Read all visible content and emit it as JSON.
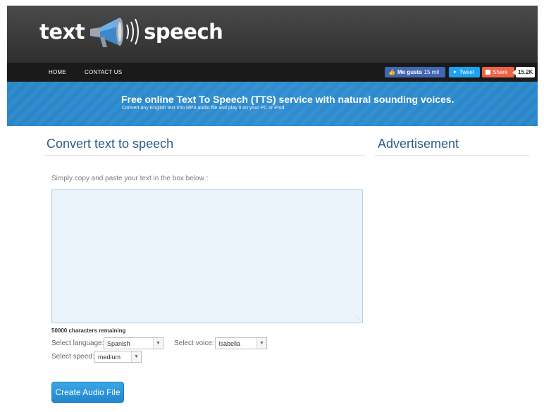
{
  "header": {
    "logo_left": "text",
    "logo_right": "speech"
  },
  "nav": {
    "home": "HOME",
    "contact": "CONTACT US",
    "like_label": "Me gusta",
    "like_count": "15 mil",
    "tweet_label": "Tweet",
    "share_label": "Share",
    "share_count": "15.2K"
  },
  "banner": {
    "title": "Free online Text To Speech (TTS) service with natural sounding voices.",
    "subtitle": "Convert any English text into MP3 audio file and play it on your PC or iPod."
  },
  "main": {
    "title": "Convert text to speech",
    "instruction": "Simply copy and paste your text in the box below :",
    "textarea_value": "",
    "chars_remaining": "50000 characters remaining",
    "language_label": "Select language:",
    "language_value": "Spanish",
    "voice_label": "Select voice:",
    "voice_value": "Isabella",
    "speed_label": "Select speed:",
    "speed_value": "medium",
    "create_button": "Create Audio File"
  },
  "aside": {
    "title": "Advertisement"
  },
  "colors": {
    "header_bg": "#3a3a3a",
    "nav_bg": "#1a1a1a",
    "banner_bg": "#2f8dd0",
    "title_color": "#2d5b8a",
    "button_bg": "#2a93d8"
  }
}
